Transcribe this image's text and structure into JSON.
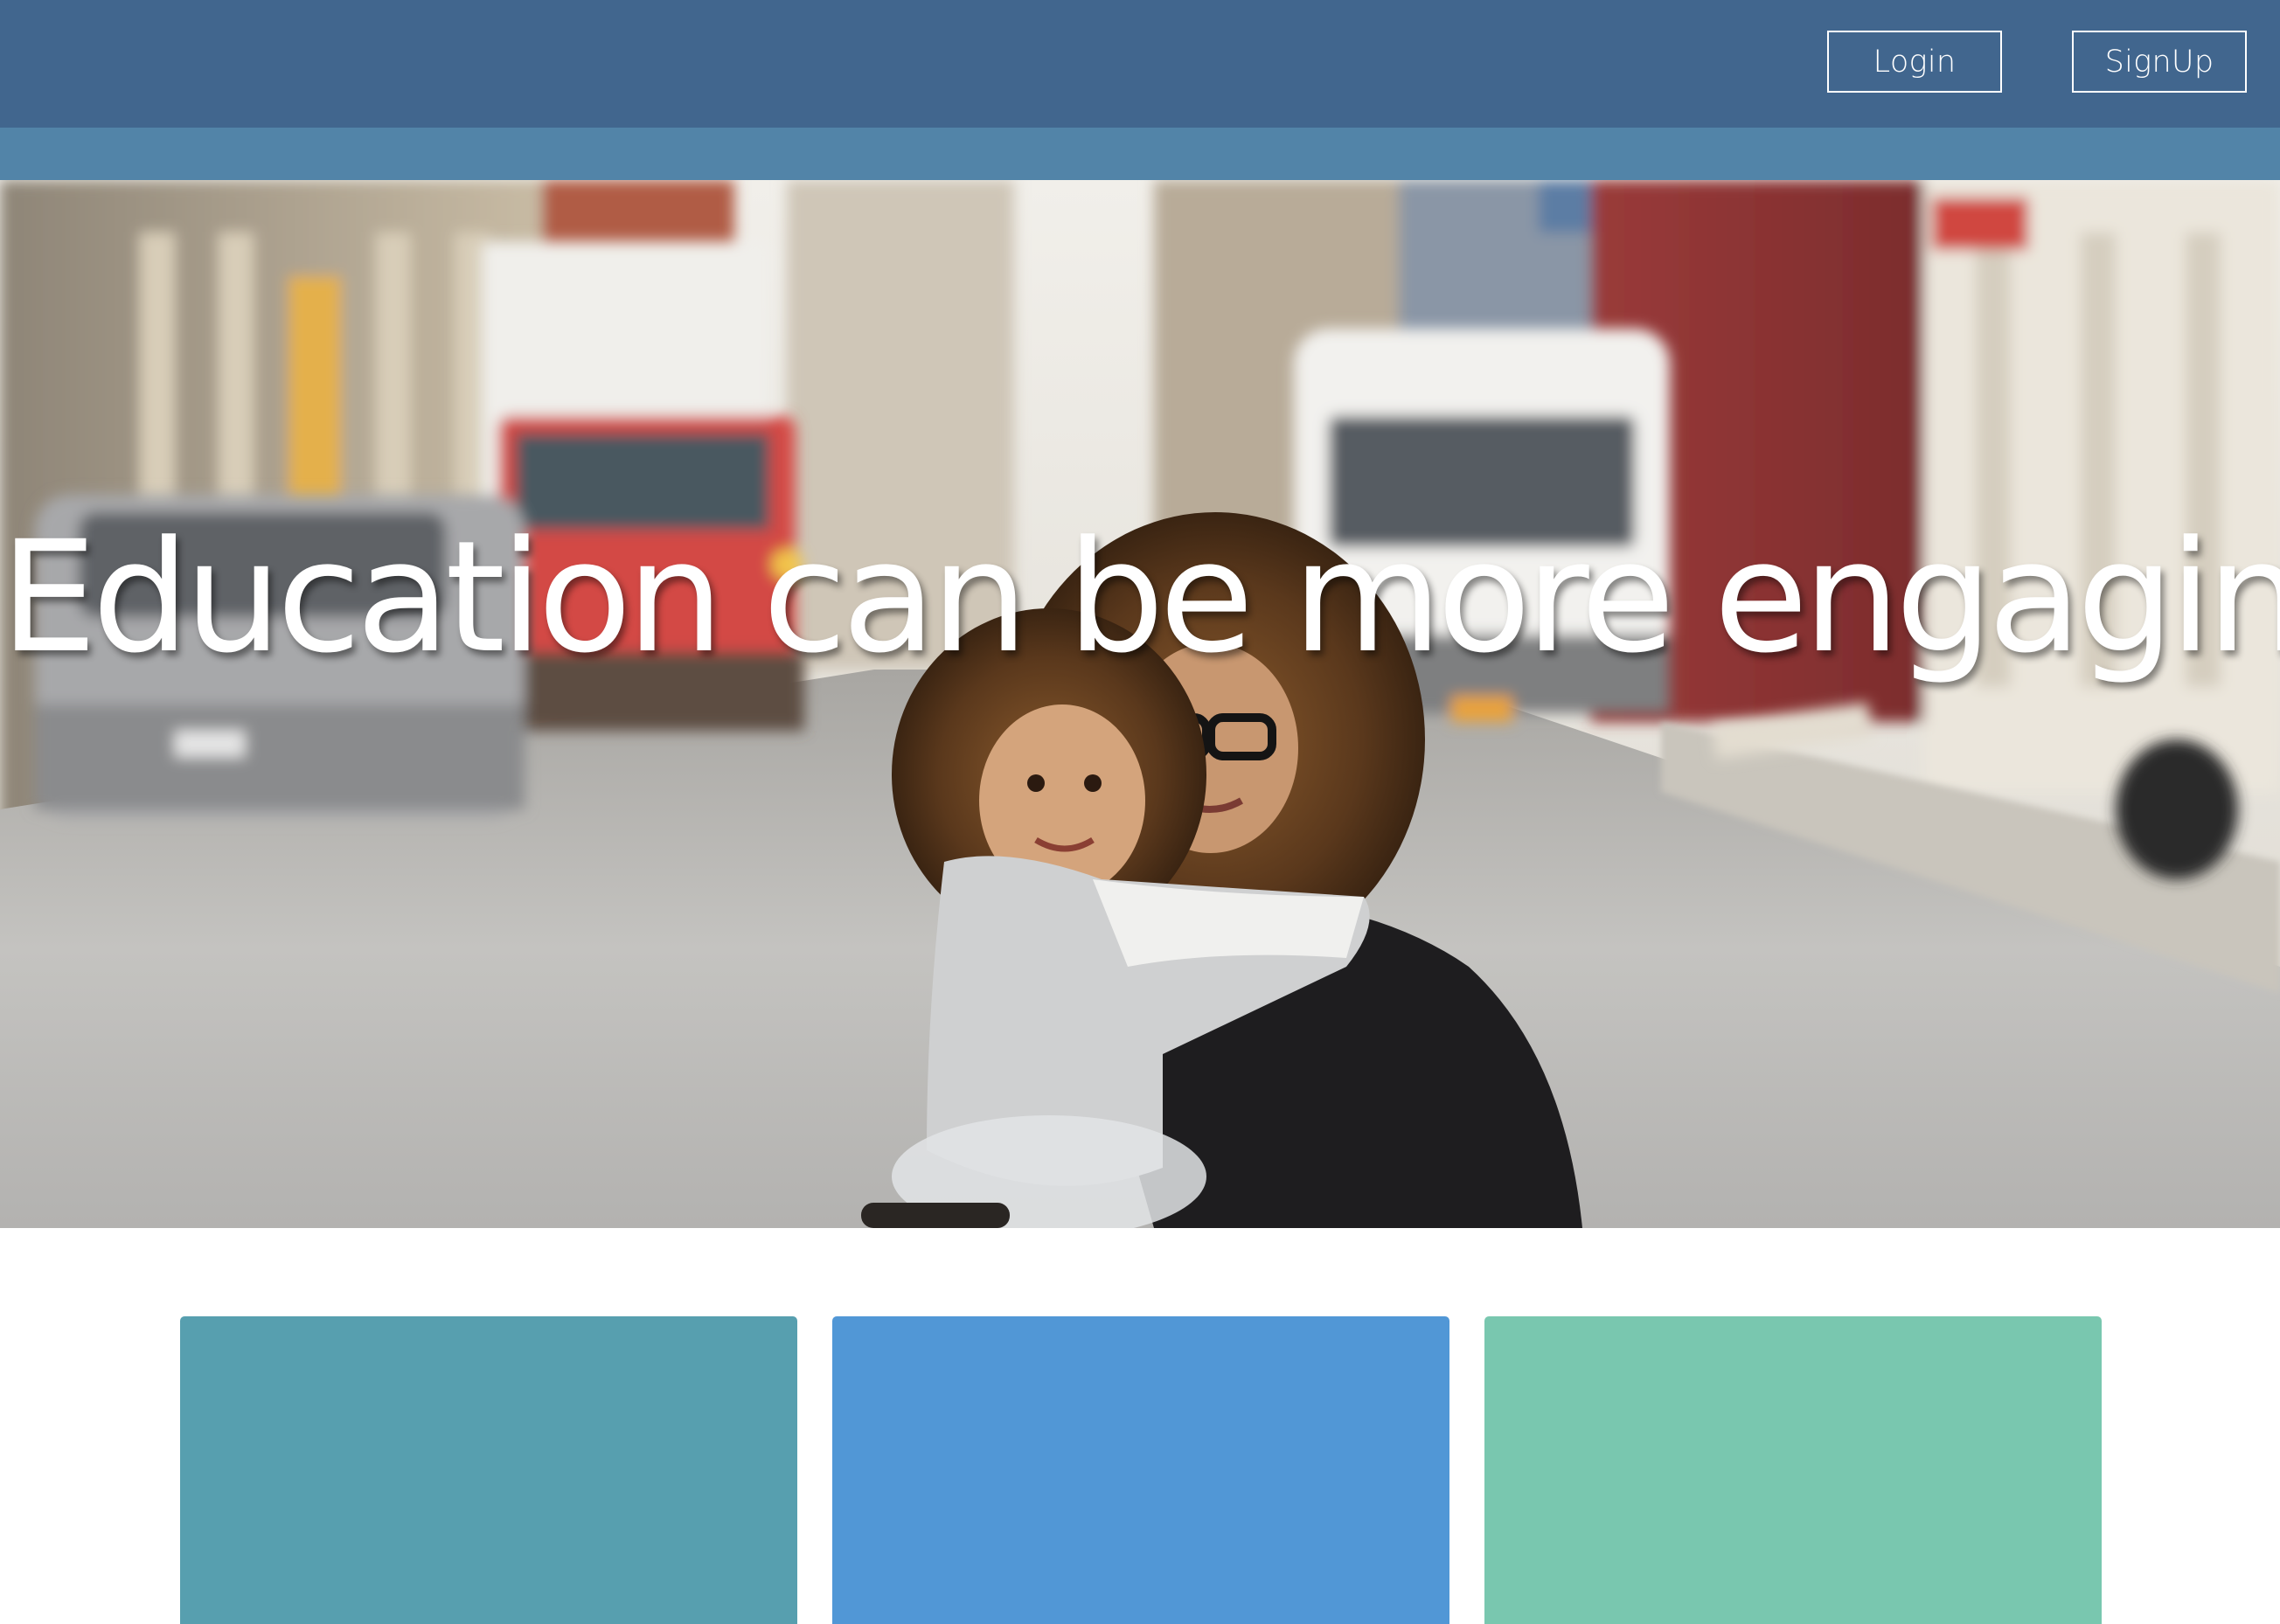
{
  "header": {
    "login_label": "Login",
    "signup_label": "SignUp",
    "background_color": "#41668e"
  },
  "subbar": {
    "background_color": "#5284a8"
  },
  "hero": {
    "title": "Education can be more engaging",
    "image": "street-photo-mother-and-child"
  },
  "cards": [
    {
      "color": "#579faf"
    },
    {
      "color": "#5197d6"
    },
    {
      "color": "#79c7af"
    }
  ]
}
